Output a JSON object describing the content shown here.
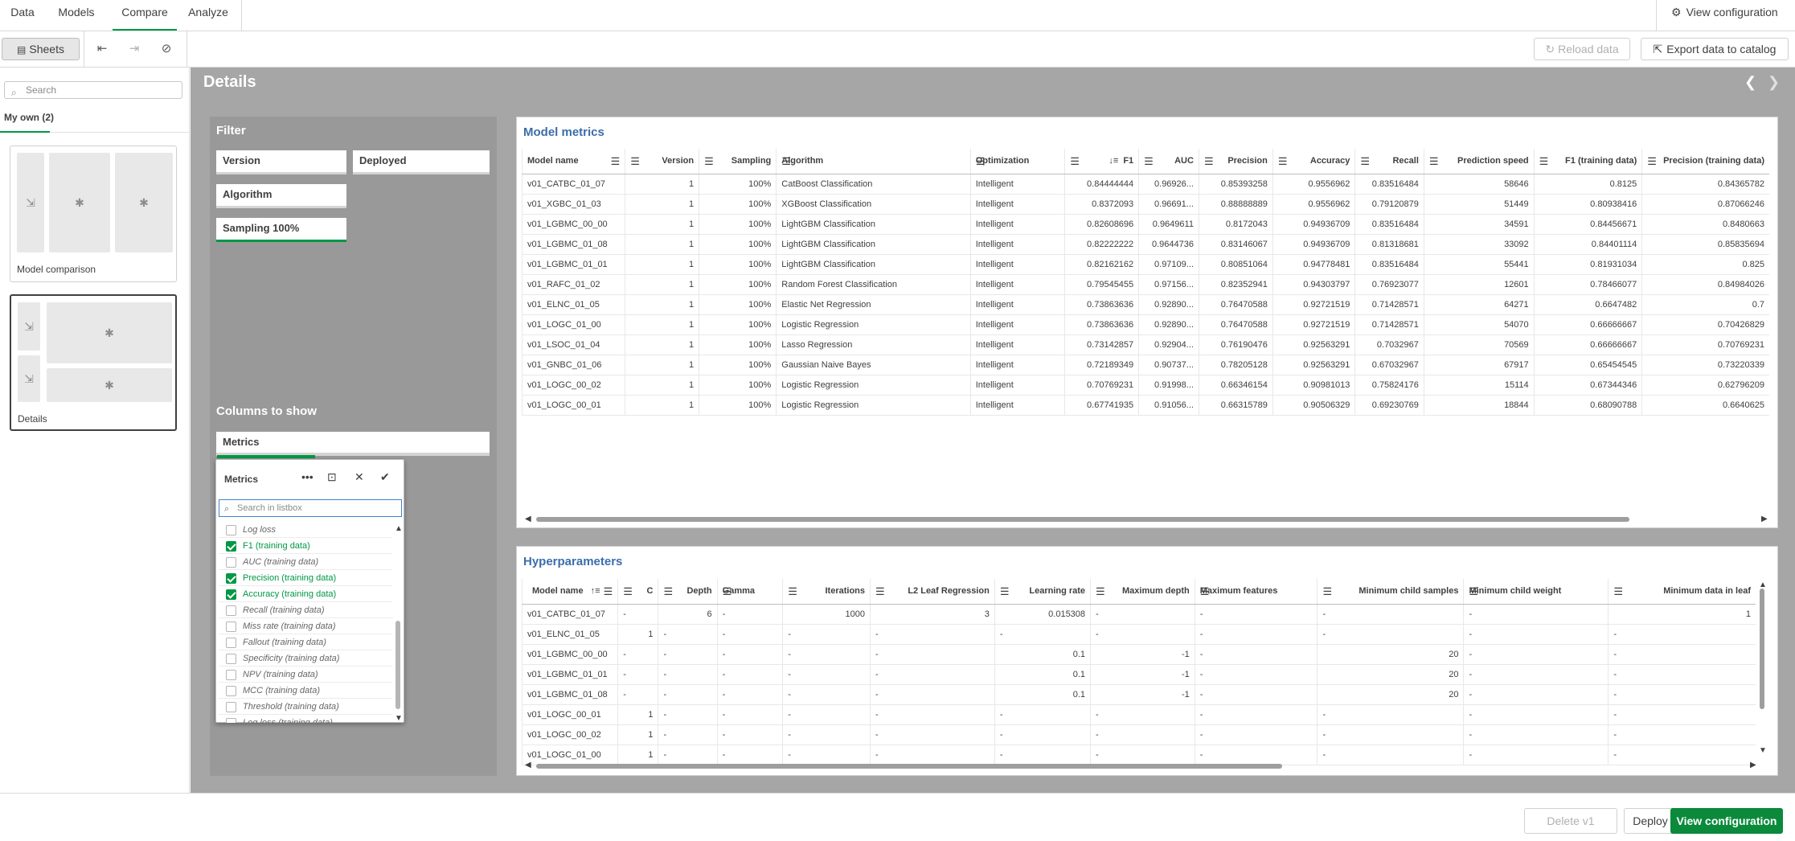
{
  "tabs": [
    {
      "label": "Data"
    },
    {
      "label": "Models"
    },
    {
      "label": "Compare"
    },
    {
      "label": "Analyze"
    }
  ],
  "active_tab": "Compare",
  "top_right": {
    "view_configuration": "View configuration"
  },
  "toolbar": {
    "sheets_label": "Sheets",
    "reload_label": "Reload data",
    "export_label": "Export data to catalog"
  },
  "left_panel": {
    "search_placeholder": "Search",
    "section_label": "My own (2)",
    "sheets": [
      {
        "name": "Model comparison"
      },
      {
        "name": "Details"
      }
    ]
  },
  "sheet": {
    "title": "Details"
  },
  "filter": {
    "title": "Filter",
    "boxes": [
      "Version",
      "Deployed",
      "Algorithm",
      "Sampling 100%"
    ],
    "columns_title": "Columns to show",
    "metrics_box": "Metrics"
  },
  "listbox": {
    "title": "Metrics",
    "search_placeholder": "Search in listbox",
    "items": [
      {
        "label": "Log loss",
        "selected": false
      },
      {
        "label": "F1 (training data)",
        "selected": true
      },
      {
        "label": "AUC (training data)",
        "selected": false
      },
      {
        "label": "Precision (training data)",
        "selected": true
      },
      {
        "label": "Accuracy (training data)",
        "selected": true
      },
      {
        "label": "Recall (training data)",
        "selected": false
      },
      {
        "label": "Miss rate (training data)",
        "selected": false
      },
      {
        "label": "Fallout (training data)",
        "selected": false
      },
      {
        "label": "Specificity (training data)",
        "selected": false
      },
      {
        "label": "NPV (training data)",
        "selected": false
      },
      {
        "label": "MCC (training data)",
        "selected": false
      },
      {
        "label": "Threshold (training data)",
        "selected": false
      },
      {
        "label": "Log loss (training data)",
        "selected": false
      }
    ]
  },
  "model_metrics": {
    "title": "Model metrics",
    "columns": [
      "Model name",
      "Version",
      "Sampling",
      "Algorithm",
      "Optimization",
      "F1",
      "AUC",
      "Precision",
      "Accuracy",
      "Recall",
      "Prediction speed",
      "F1 (training data)",
      "Precision (training data)"
    ],
    "rows": [
      [
        "v01_CATBC_01_07",
        "1",
        "100%",
        "CatBoost Classification",
        "Intelligent",
        "0.84444444",
        "0.96926...",
        "0.85393258",
        "0.9556962",
        "0.83516484",
        "58646",
        "0.8125",
        "0.84365782"
      ],
      [
        "v01_XGBC_01_03",
        "1",
        "100%",
        "XGBoost Classification",
        "Intelligent",
        "0.8372093",
        "0.96691...",
        "0.88888889",
        "0.9556962",
        "0.79120879",
        "51449",
        "0.80938416",
        "0.87066246"
      ],
      [
        "v01_LGBMC_00_00",
        "1",
        "100%",
        "LightGBM Classification",
        "Intelligent",
        "0.82608696",
        "0.9649611",
        "0.8172043",
        "0.94936709",
        "0.83516484",
        "34591",
        "0.84456671",
        "0.8480663"
      ],
      [
        "v01_LGBMC_01_08",
        "1",
        "100%",
        "LightGBM Classification",
        "Intelligent",
        "0.82222222",
        "0.9644736",
        "0.83146067",
        "0.94936709",
        "0.81318681",
        "33092",
        "0.84401114",
        "0.85835694"
      ],
      [
        "v01_LGBMC_01_01",
        "1",
        "100%",
        "LightGBM Classification",
        "Intelligent",
        "0.82162162",
        "0.97109...",
        "0.80851064",
        "0.94778481",
        "0.83516484",
        "55441",
        "0.81931034",
        "0.825"
      ],
      [
        "v01_RAFC_01_02",
        "1",
        "100%",
        "Random Forest Classification",
        "Intelligent",
        "0.79545455",
        "0.97156...",
        "0.82352941",
        "0.94303797",
        "0.76923077",
        "12601",
        "0.78466077",
        "0.84984026"
      ],
      [
        "v01_ELNC_01_05",
        "1",
        "100%",
        "Elastic Net Regression",
        "Intelligent",
        "0.73863636",
        "0.92890...",
        "0.76470588",
        "0.92721519",
        "0.71428571",
        "64271",
        "0.6647482",
        "0.7"
      ],
      [
        "v01_LOGC_01_00",
        "1",
        "100%",
        "Logistic Regression",
        "Intelligent",
        "0.73863636",
        "0.92890...",
        "0.76470588",
        "0.92721519",
        "0.71428571",
        "54070",
        "0.66666667",
        "0.70426829"
      ],
      [
        "v01_LSOC_01_04",
        "1",
        "100%",
        "Lasso Regression",
        "Intelligent",
        "0.73142857",
        "0.92904...",
        "0.76190476",
        "0.92563291",
        "0.7032967",
        "70569",
        "0.66666667",
        "0.70769231"
      ],
      [
        "v01_GNBC_01_06",
        "1",
        "100%",
        "Gaussian Naive Bayes",
        "Intelligent",
        "0.72189349",
        "0.90737...",
        "0.78205128",
        "0.92563291",
        "0.67032967",
        "67917",
        "0.65454545",
        "0.73220339"
      ],
      [
        "v01_LOGC_00_02",
        "1",
        "100%",
        "Logistic Regression",
        "Intelligent",
        "0.70769231",
        "0.91998...",
        "0.66346154",
        "0.90981013",
        "0.75824176",
        "15114",
        "0.67344346",
        "0.62796209"
      ],
      [
        "v01_LOGC_00_01",
        "1",
        "100%",
        "Logistic Regression",
        "Intelligent",
        "0.67741935",
        "0.91056...",
        "0.66315789",
        "0.90506329",
        "0.69230769",
        "18844",
        "0.68090788",
        "0.6640625"
      ]
    ]
  },
  "hyperparameters": {
    "title": "Hyperparameters",
    "columns": [
      "Model name",
      "C",
      "Depth",
      "Gamma",
      "Iterations",
      "L2 Leaf Regression",
      "Learning rate",
      "Maximum depth",
      "Maximum features",
      "Minimum child samples",
      "Minimum child weight",
      "Minimum data in leaf"
    ],
    "rows": [
      [
        "v01_CATBC_01_07",
        "-",
        "6",
        "-",
        "1000",
        "3",
        "0.015308",
        "-",
        "-",
        "-",
        "-",
        "1"
      ],
      [
        "v01_ELNC_01_05",
        "1",
        "-",
        "-",
        "-",
        "-",
        "-",
        "-",
        "-",
        "-",
        "-",
        "-"
      ],
      [
        "v01_LGBMC_00_00",
        "-",
        "-",
        "-",
        "-",
        "-",
        "0.1",
        "-1",
        "-",
        "20",
        "-",
        "-"
      ],
      [
        "v01_LGBMC_01_01",
        "-",
        "-",
        "-",
        "-",
        "-",
        "0.1",
        "-1",
        "-",
        "20",
        "-",
        "-"
      ],
      [
        "v01_LGBMC_01_08",
        "-",
        "-",
        "-",
        "-",
        "-",
        "0.1",
        "-1",
        "-",
        "20",
        "-",
        "-"
      ],
      [
        "v01_LOGC_00_01",
        "1",
        "-",
        "-",
        "-",
        "-",
        "-",
        "-",
        "-",
        "-",
        "-",
        "-"
      ],
      [
        "v01_LOGC_00_02",
        "1",
        "-",
        "-",
        "-",
        "-",
        "-",
        "-",
        "-",
        "-",
        "-",
        "-"
      ],
      [
        "v01_LOGC_01_00",
        "1",
        "-",
        "-",
        "-",
        "-",
        "-",
        "-",
        "-",
        "-",
        "-",
        "-"
      ]
    ]
  },
  "bottom_bar": {
    "delete_label": "Delete v1",
    "deploy_label": "Deploy",
    "view_config_label": "View configuration"
  },
  "colors": {
    "accent": "#009845",
    "title_blue": "#3b6dab",
    "primary_button": "#0b8a3c"
  }
}
